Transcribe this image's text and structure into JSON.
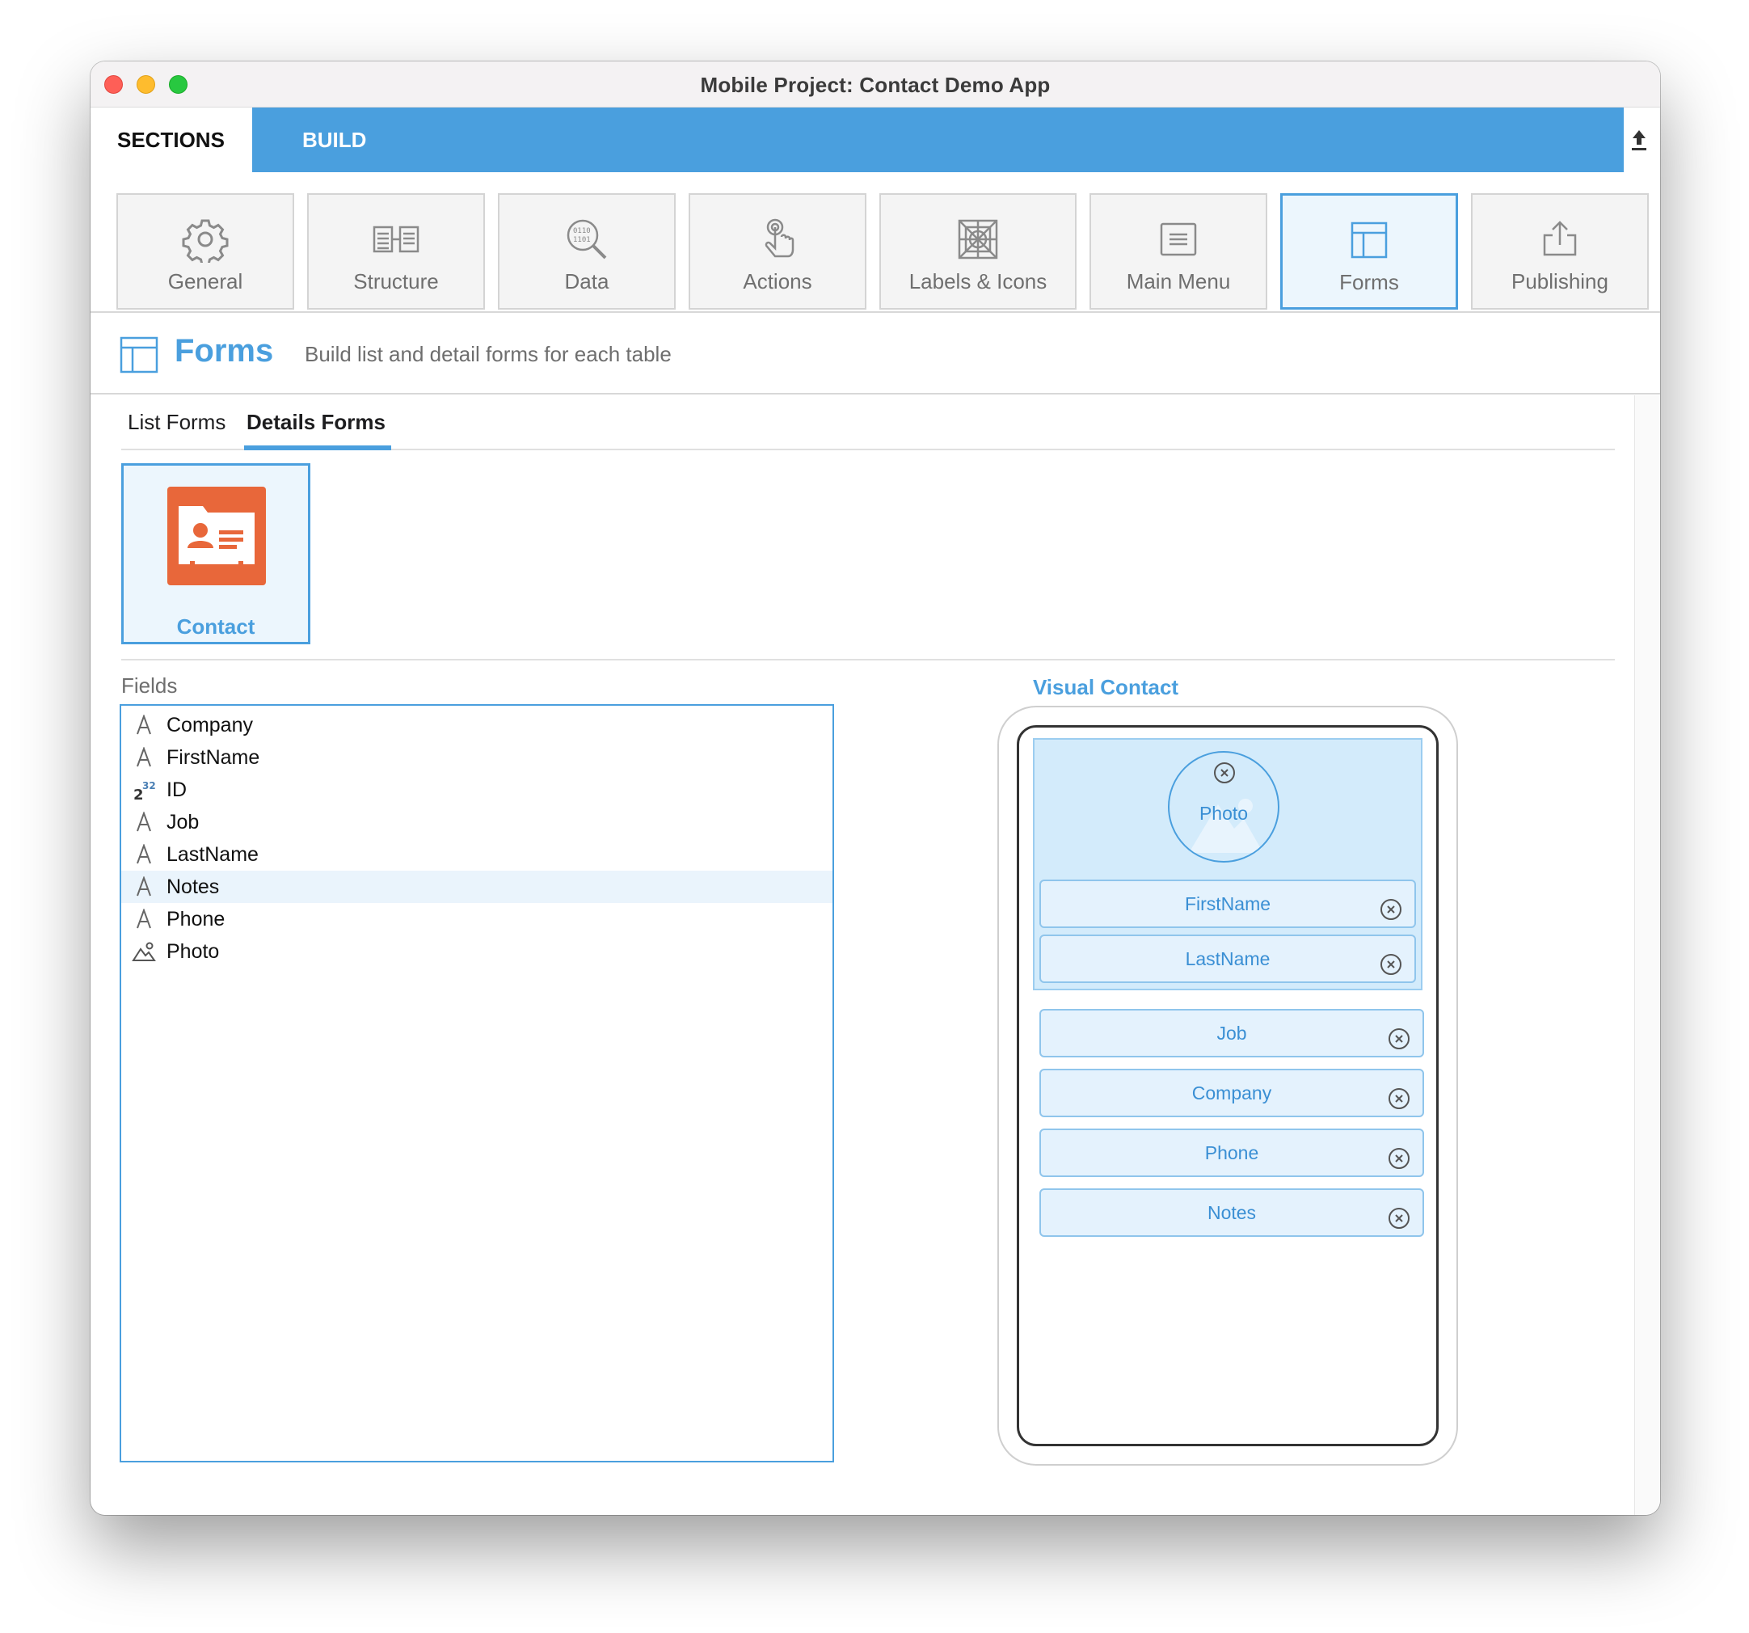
{
  "window": {
    "title": "Mobile Project: Contact Demo App"
  },
  "section_tabs": {
    "sections": "SECTIONS",
    "build": "BUILD"
  },
  "toolbar": {
    "items": [
      {
        "label": "General",
        "icon": "gear-icon"
      },
      {
        "label": "Structure",
        "icon": "structure-icon"
      },
      {
        "label": "Data",
        "icon": "data-icon"
      },
      {
        "label": "Actions",
        "icon": "touch-icon"
      },
      {
        "label": "Labels & Icons",
        "icon": "labels-icons-icon"
      },
      {
        "label": "Main Menu",
        "icon": "menu-icon"
      },
      {
        "label": "Forms",
        "icon": "forms-icon",
        "active": true
      },
      {
        "label": "Publishing",
        "icon": "publish-icon"
      }
    ]
  },
  "page": {
    "title": "Forms",
    "subtitle": "Build list and detail forms for each table"
  },
  "subtabs": {
    "list": "List Forms",
    "details": "Details Forms",
    "active": "details"
  },
  "tables": [
    {
      "label": "Contact",
      "icon": "contact-card-icon"
    }
  ],
  "fields": {
    "label": "Fields",
    "items": [
      {
        "name": "Company",
        "type": "text"
      },
      {
        "name": "FirstName",
        "type": "text"
      },
      {
        "name": "ID",
        "type": "number"
      },
      {
        "name": "Job",
        "type": "text"
      },
      {
        "name": "LastName",
        "type": "text"
      },
      {
        "name": "Notes",
        "type": "text",
        "selected": true
      },
      {
        "name": "Phone",
        "type": "text"
      },
      {
        "name": "Photo",
        "type": "image"
      }
    ]
  },
  "visual": {
    "title": "Visual Contact",
    "photo_label": "Photo",
    "header_fields": [
      "FirstName",
      "LastName"
    ],
    "body_fields": [
      "Job",
      "Company",
      "Phone",
      "Notes"
    ]
  },
  "colors": {
    "accent": "#4a9fde",
    "tile": "#e8673a",
    "panel": "#d3ebfb"
  }
}
